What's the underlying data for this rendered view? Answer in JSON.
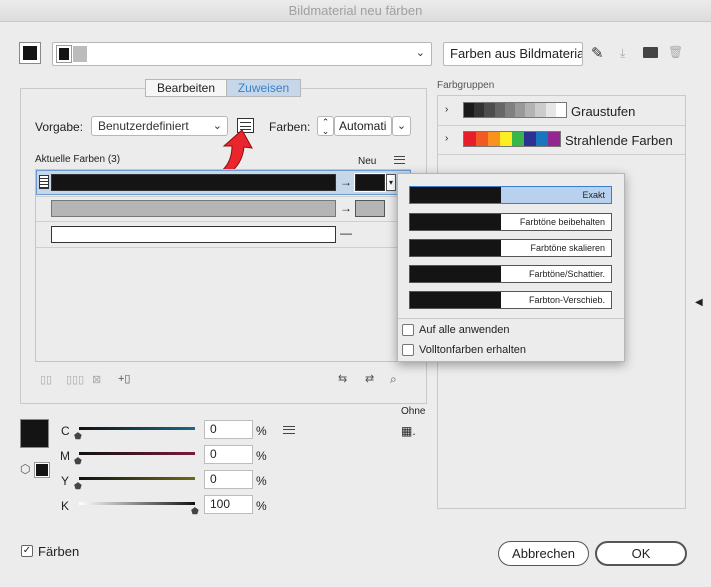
{
  "window": {
    "title": "Bildmaterial neu färben"
  },
  "top": {
    "group_field_value": "",
    "preset_button": "Farben aus Bildmateria"
  },
  "tabs": {
    "edit": "Bearbeiten",
    "assign": "Zuweisen"
  },
  "assign": {
    "preset_label": "Vorgabe:",
    "preset_value": "Benutzerdefiniert",
    "colors_label": "Farben:",
    "colors_value": "Automati"
  },
  "current": {
    "header": "Aktuelle Farben (3)",
    "new_header": "Neu",
    "arrow": "→",
    "dash": "—"
  },
  "popup": {
    "items": [
      "Exakt",
      "Farbtöne beibehalten",
      "Farbtöne skalieren",
      "Farbtöne/Schattier.",
      "Farbton-Verschieb."
    ],
    "apply_all": "Auf alle anwenden",
    "keep_spot": "Volltonfarben erhalten"
  },
  "groups": {
    "label": "Farbgruppen",
    "items": [
      {
        "name": "Graustufen",
        "colors": [
          "#1a1a1a",
          "#333",
          "#4d4d4d",
          "#666",
          "#808080",
          "#999",
          "#b3b3b3",
          "#ccc",
          "#e6e6e6",
          "#fff"
        ]
      },
      {
        "name": "Strahlende Farben",
        "colors": [
          "#e61d2b",
          "#f15a24",
          "#f7931e",
          "#fcee21",
          "#39b54a",
          "#2e3192",
          "#1b75bc",
          "#92278f"
        ]
      }
    ]
  },
  "cmyk": {
    "none_label": "Ohne",
    "channels": [
      {
        "label": "C",
        "value": "0",
        "unit": "%"
      },
      {
        "label": "M",
        "value": "0",
        "unit": "%"
      },
      {
        "label": "Y",
        "value": "0",
        "unit": "%"
      },
      {
        "label": "K",
        "value": "100",
        "unit": "%"
      }
    ]
  },
  "footer": {
    "recolor_label": "Färben",
    "cancel": "Abbrechen",
    "ok": "OK"
  },
  "colors": {
    "accent": "#3b8bd8",
    "tab_active": "#c7d7ea",
    "black": "#141414",
    "grey": "#b5b5b5"
  }
}
